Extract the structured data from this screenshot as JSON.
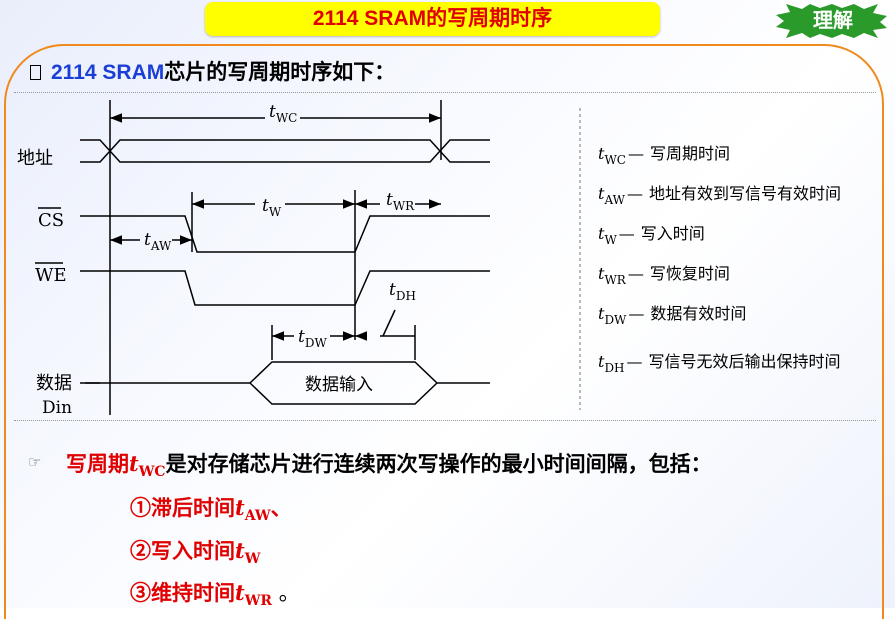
{
  "header": {
    "title": "2114 SRAM的写周期时序",
    "badge": "理解"
  },
  "intro": {
    "prefix": "2114 SRAM",
    "text": "芯片的写周期时序如下："
  },
  "diagram": {
    "signals": {
      "address": "地址",
      "cs": "CS",
      "we": "WE",
      "data_line1": "数据",
      "data_line2": "Din"
    },
    "data_box": "数据输入",
    "labels": {
      "twc": "t",
      "twc_sub": "WC",
      "tw": "t",
      "tw_sub": "W",
      "twr": "t",
      "twr_sub": "WR",
      "taw": "t",
      "taw_sub": "AW",
      "tdw": "t",
      "tdw_sub": "DW",
      "tdh": "t",
      "tdh_sub": "DH"
    }
  },
  "legend": [
    {
      "sym": "t",
      "sub": "WC",
      "desc": "写周期时间"
    },
    {
      "sym": "t",
      "sub": "AW",
      "desc": "地址有效到写信号有效时间"
    },
    {
      "sym": "t",
      "sub": "W",
      "desc": "写入时间"
    },
    {
      "sym": "t",
      "sub": "WR",
      "desc": "写恢复时间"
    },
    {
      "sym": "t",
      "sub": "DW",
      "desc": "数据有效时间"
    },
    {
      "sym": "t",
      "sub": "DH",
      "desc": "写信号无效后输出保持时间"
    }
  ],
  "legend_dash": "—",
  "summary": {
    "lead": "写周期",
    "sym": "t",
    "sub": "WC",
    "rest": "是对存储芯片进行连续两次写操作的最小时间间隔，包括：",
    "items": [
      {
        "prefix": "①滞后时间",
        "sym": "t",
        "sub": "AW",
        "suffix": "、"
      },
      {
        "prefix": "②写入时间",
        "sym": "t",
        "sub": "W",
        "suffix": ""
      },
      {
        "prefix": "③维持时间",
        "sym": "t",
        "sub": "WR",
        "suffix": " 。"
      }
    ]
  },
  "colors": {
    "title_bg": "#ffff00",
    "title_text": "#e00000",
    "accent_blue": "#1a3fd6",
    "frame": "#f08a1c",
    "badge": "#2a9a2a"
  }
}
